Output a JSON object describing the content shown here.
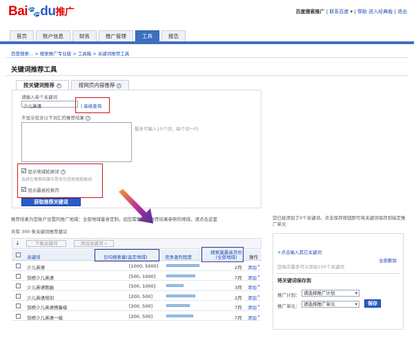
{
  "header": {
    "logo_text": "Bai",
    "logo_du": "du",
    "logo_tuiguang": "推广",
    "account_name": "百度搜索推广",
    "links": [
      "联系百度",
      "帮助",
      "进入经典版",
      "退出"
    ]
  },
  "tabs": [
    {
      "label": "首页"
    },
    {
      "label": "账户信息"
    },
    {
      "label": "财务"
    },
    {
      "label": "推广管理"
    },
    {
      "label": "工具",
      "active": true
    },
    {
      "label": "报告"
    }
  ],
  "breadcrumb": "百度搜索... > 搜索推广专业版 > 工具箱 > 关键词推荐工具",
  "page_title": "关键词推荐工具",
  "panel_tabs": [
    "按关键词推荐",
    "按网页内容推荐"
  ],
  "form": {
    "single_kw_label": "请输入单个关键词",
    "single_kw_value": "少儿英语",
    "advanced_query": "| 高级查询",
    "exclude_label": "不显示包含以下词汇的推荐结果",
    "exclude_hint": "最多可输入10个词，每个词一行",
    "opt_region": "显示地域拓展词",
    "opt_region_hint": "选择在推荐结果中是否包括地域拓展词",
    "opt_peak": "显示最高检索月",
    "submit": "获取推荐关键词"
  },
  "notes": {
    "region_note": "推荐结果为您账户设置的推广地域：全部地域量身定制，如您需要调整推荐结果参照的地域，请点击这里",
    "count_text": "共有 300 条关键词推荐建议",
    "right_note": "您已经添加了0个关键词，点击保存按钮即可将关键词保存到指定推广单元"
  },
  "toolbar": {
    "download": "下载关键词",
    "add_kw": "添加关键词 »"
  },
  "table": {
    "headers": [
      "关键词",
      "日均搜索量(选定地域)",
      "竞争激烈程度",
      "搜索量最高月份(全部地域)",
      "操作"
    ],
    "rows": [
      {
        "kw": "少儿英语",
        "vol": "[1000, 5000]",
        "competition": 0.85,
        "month": "2月",
        "op": "添加"
      },
      {
        "kw": "剑桥少儿英语",
        "vol": "[500, 1000]",
        "competition": 0.75,
        "month": "7月",
        "op": "添加"
      },
      {
        "kw": "少儿英语歌曲",
        "vol": "[500, 1000]",
        "competition": 0.45,
        "month": "3月",
        "op": "添加"
      },
      {
        "kw": "少儿英语培训",
        "vol": "[200, 500]",
        "competition": 0.75,
        "month": "2月",
        "op": "添加"
      },
      {
        "kw": "剑桥少儿英语预备级",
        "vol": "[200, 500]",
        "competition": 0.6,
        "month": "7月",
        "op": "添加"
      },
      {
        "kw": "剑桥少儿英语一级",
        "vol": "[200, 500]",
        "competition": 0.7,
        "month": "7月",
        "op": "添加"
      }
    ]
  },
  "right_panel": {
    "add_other": "+点击输入其它关键词",
    "clear_all": "全部删除",
    "max_hint": "您每次最多可以添加100个关键词",
    "save_to": "将关键词保存到",
    "plan_label": "推广计划：",
    "plan_value": "请选择推广计划",
    "unit_label": "推广单元：",
    "unit_value": "请选择推广单元",
    "save_btn": "保存"
  },
  "colors": {
    "brand_blue": "#3d6fbf",
    "brand_red": "#e10602",
    "highlight_red": "#c8141c",
    "highlight_navy": "#2a2f8f"
  }
}
